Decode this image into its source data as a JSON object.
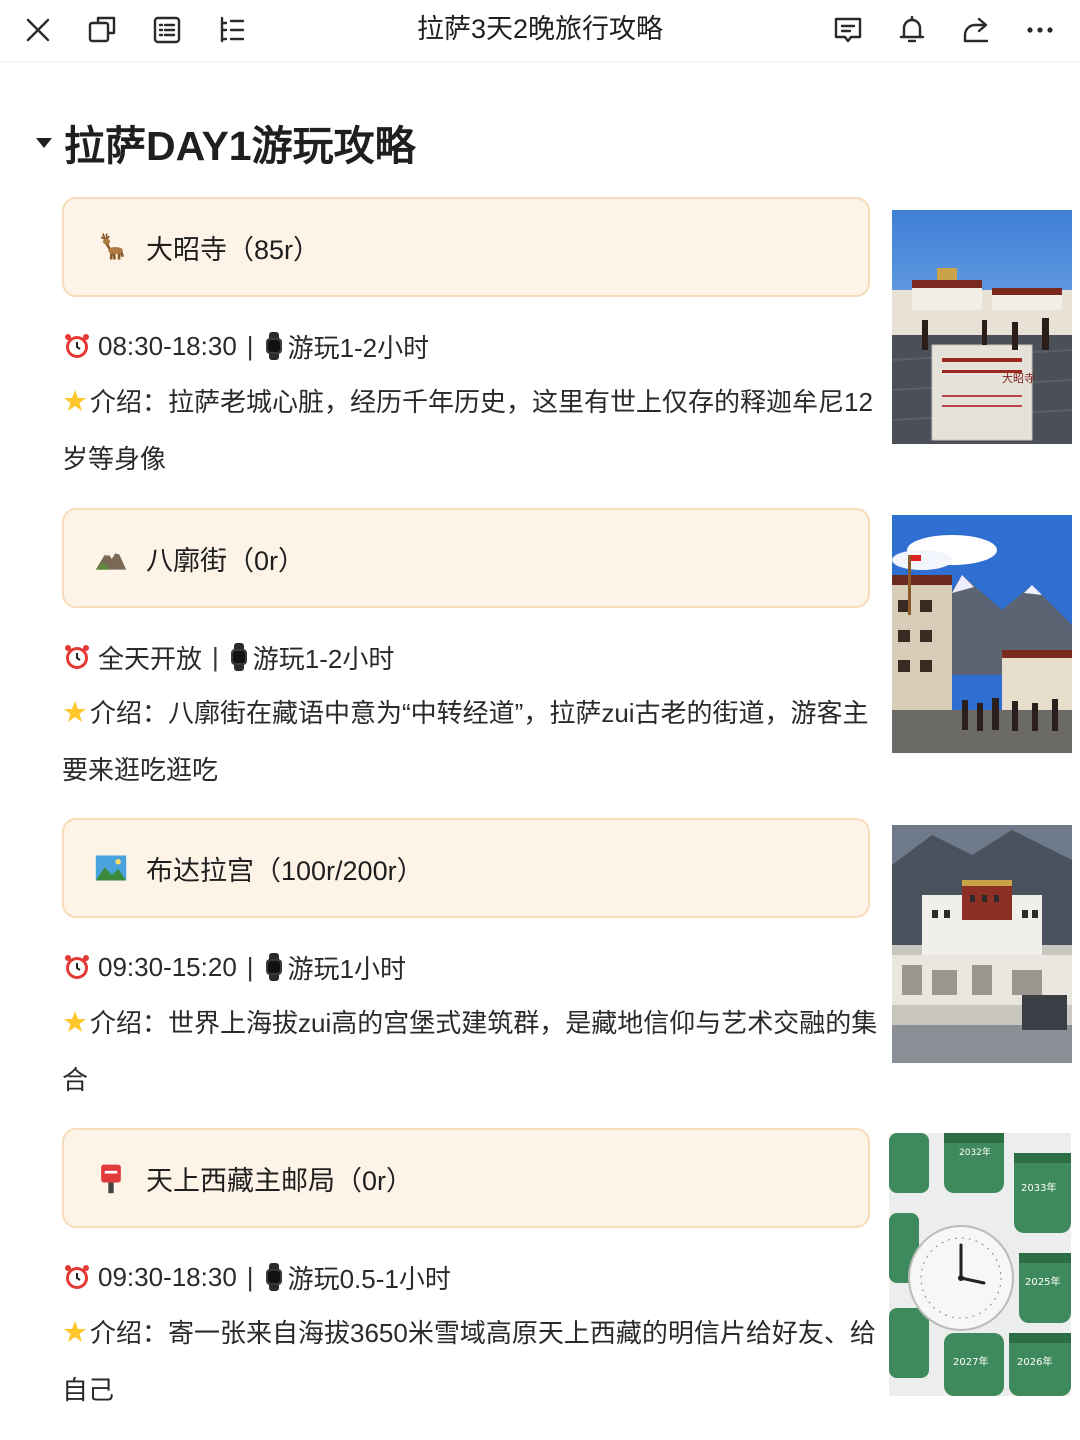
{
  "toolbar": {
    "title": "拉萨3天2晚旅行攻略",
    "left_icons": [
      "close-icon",
      "window-icon",
      "list-icon",
      "outline-icon"
    ],
    "right_icons": [
      "comment-icon",
      "bell-icon",
      "share-icon",
      "more-icon"
    ]
  },
  "section": {
    "heading": "拉萨DAY1游玩攻略"
  },
  "spots": [
    {
      "emoji": "deer-emoji",
      "name": "大昭寺（85r）",
      "hours": "08:30-18:30",
      "duration": "游玩1-2小时",
      "desc": "介绍：拉萨老城心脏，经历千年历史，这里有世上仅存的释迦牟尼12岁等身像"
    },
    {
      "emoji": "mountain-emoji",
      "name": "八廓街（0r）",
      "hours": "全天开放",
      "duration": "游玩1-2小时",
      "desc": "介绍：八廓街在藏语中意为“中转经道”，拉萨zui古老的街道，游客主要来逛吃逛吃"
    },
    {
      "emoji": "landscape-emoji",
      "name": "布达拉宫（100r/200r）",
      "hours": "09:30-15:20",
      "duration": "游玩1小时",
      "desc": "介绍：世界上海拔zui高的宫堡式建筑群，是藏地信仰与艺术交融的集合"
    },
    {
      "emoji": "postbox-emoji",
      "name": "天上西藏主邮局（0r）",
      "hours": "09:30-18:30",
      "duration": "游玩0.5-1小时",
      "desc": "介绍：寄一张来自海拔3650米雪域高原天上西藏的明信片给好友、给自己"
    }
  ],
  "photo_captions": {
    "photo1_sign": "大昭寺",
    "photo4_years": [
      "2032年",
      "2033年",
      "2025年",
      "2026年",
      "2027年"
    ]
  }
}
